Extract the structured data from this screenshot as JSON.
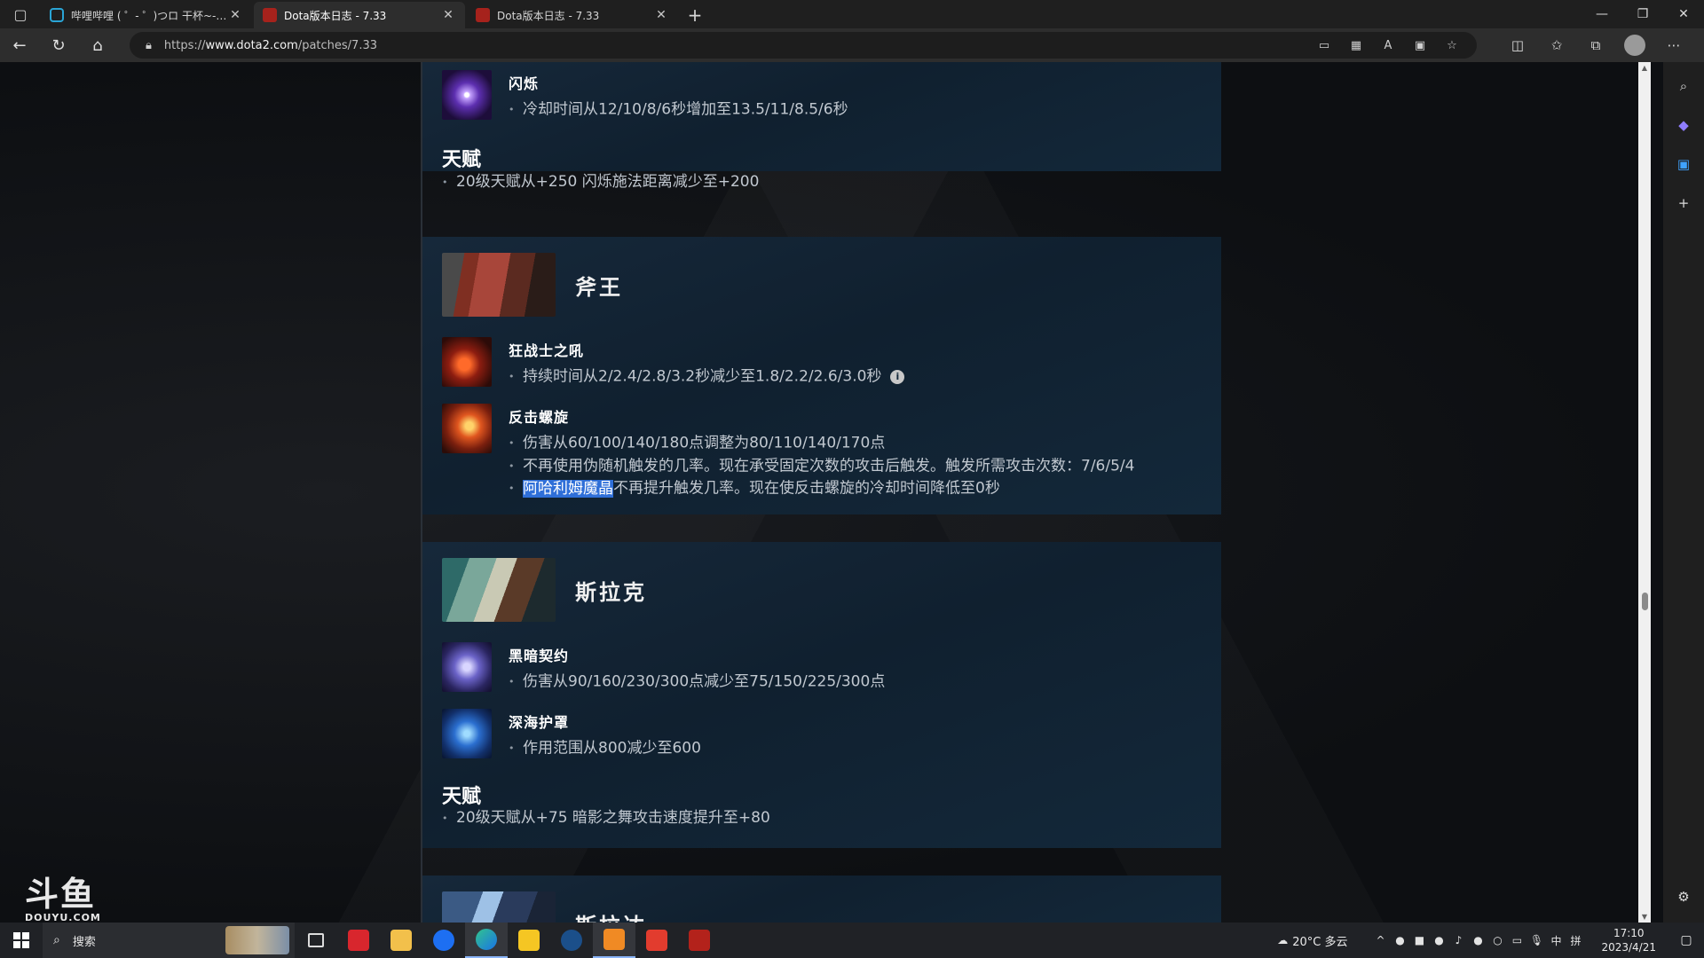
{
  "browser": {
    "tabs": [
      {
        "title": "哔哩哔哩 ( ゜- ゜)つロ 干杯~-bilibili",
        "favicon": "bilibili-icon",
        "active": false
      },
      {
        "title": "Dota版本日志 - 7.33",
        "favicon": "dota-icon",
        "active": true
      },
      {
        "title": "Dota版本日志 - 7.33",
        "favicon": "dota-icon",
        "active": false
      }
    ],
    "tab_close_glyph": "✕",
    "new_tab_glyph": "+",
    "url_scheme": "https://",
    "url_host": "www.dota2.com",
    "url_path": "/patches/7.33"
  },
  "page": {
    "top_section": {
      "ability": {
        "name": "闪烁",
        "icon": "blink-icon",
        "notes": [
          "冷却时间从12/10/8/6秒增加至13.5/11/8.5/6秒"
        ]
      },
      "talent_title": "天赋",
      "talent_note": "20级天赋从+250 闪烁施法距离减少至+200"
    },
    "heroes": [
      {
        "name": "斧王",
        "portrait": "axe-portrait",
        "abilities": [
          {
            "name": "狂战士之吼",
            "icon": "berserkers-call-icon",
            "notes": [
              "持续时间从2/2.4/2.8/3.2秒减少至1.8/2.2/2.6/3.0秒"
            ],
            "info": "i"
          },
          {
            "name": "反击螺旋",
            "icon": "counter-helix-icon",
            "notes": [
              "伤害从60/100/140/180点调整为80/110/140/170点",
              "不再使用伪随机触发的几率。现在承受固定次数的攻击后触发。触发所需攻击次数：7/6/5/4"
            ],
            "selected_text": "阿哈利姆魔晶",
            "selected_rest": "不再提升触发几率。现在使反击螺旋的冷却时间降低至0秒"
          }
        ]
      },
      {
        "name": "斯拉克",
        "portrait": "slark-portrait",
        "abilities": [
          {
            "name": "黑暗契约",
            "icon": "dark-pact-icon",
            "notes": [
              "伤害从90/160/230/300点减少至75/150/225/300点"
            ]
          },
          {
            "name": "深海护罩",
            "icon": "depth-shroud-icon",
            "notes": [
              "作用范围从800减少至600"
            ]
          }
        ],
        "talent_title": "天赋",
        "talent_note": "20级天赋从+75 暗影之舞攻击速度提升至+80"
      },
      {
        "name": "斯拉达",
        "portrait": "slardar-portrait"
      }
    ]
  },
  "watermark": {
    "big": "斗鱼",
    "small": "DOUYU.COM"
  },
  "taskbar": {
    "search_label": "搜索",
    "weather": "20°C 多云",
    "ime_lang": "中",
    "ime_mode": "拼",
    "time": "17:10",
    "date": "2023/4/21"
  }
}
